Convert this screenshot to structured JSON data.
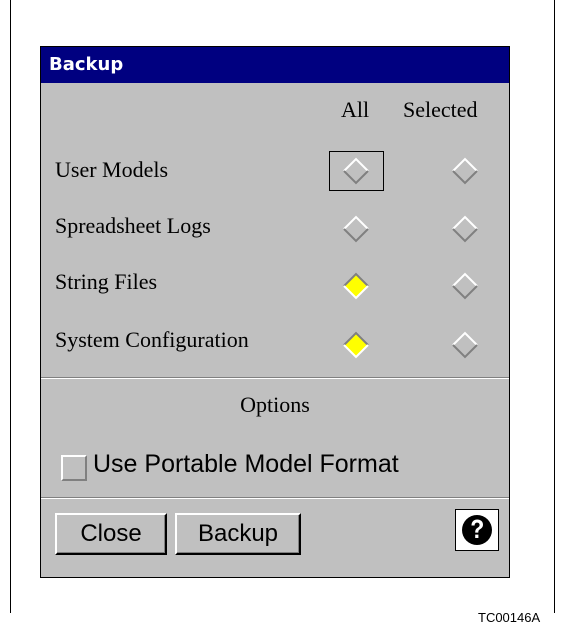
{
  "dialog": {
    "title": "Backup",
    "columns": {
      "all": "All",
      "selected": "Selected"
    },
    "rows": [
      {
        "label": "User Models",
        "all_selected": false,
        "selected_selected": false
      },
      {
        "label": "Spreadsheet Logs",
        "all_selected": false,
        "selected_selected": false
      },
      {
        "label": "String Files",
        "all_selected": true,
        "selected_selected": false
      },
      {
        "label": "System Configuration",
        "all_selected": true,
        "selected_selected": false
      }
    ],
    "options": {
      "title": "Options",
      "portable_checkbox_label": "Use Portable Model Format",
      "portable_checked": false
    },
    "buttons": {
      "close": "Close",
      "backup": "Backup"
    },
    "help_icon": "question-circle-icon"
  },
  "caption": "TC00146A",
  "colors": {
    "titlebar": "#000080",
    "dialog_bg": "#c0c0c0",
    "radio_selected": "#ffff00"
  }
}
